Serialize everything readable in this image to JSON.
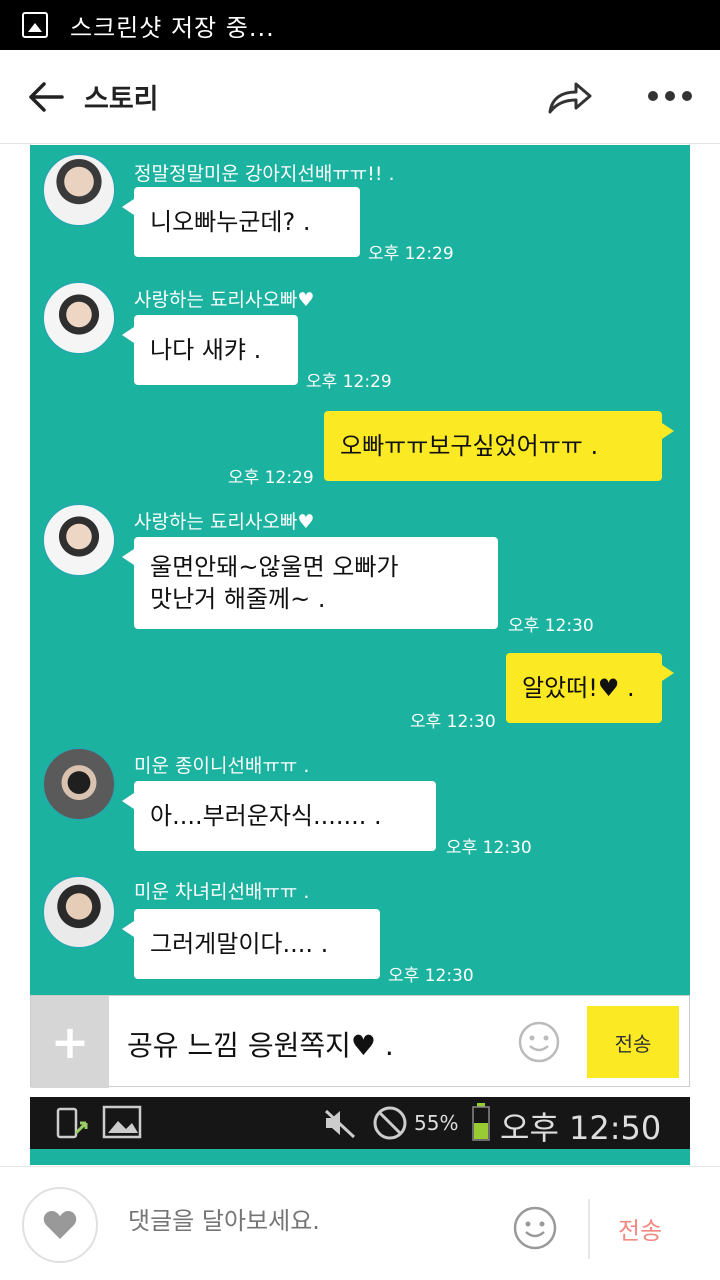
{
  "status_bar": {
    "text": "스크린샷 저장 중..."
  },
  "header": {
    "title": "스토리"
  },
  "chat": {
    "messages": [
      {
        "side": "left",
        "sender": "정말정말미운 강아지선배ㅠㅠ!! .",
        "lines": [
          "니오빠누군데? ."
        ],
        "time": "오후 12:29"
      },
      {
        "side": "left",
        "sender": "사랑하는 됴리사오빠♥",
        "lines": [
          "나다 새캬 ."
        ],
        "time": "오후 12:29"
      },
      {
        "side": "right",
        "lines": [
          "오빠ㅠㅠ보구싶었어ㅠㅠ ."
        ],
        "time": "오후 12:29"
      },
      {
        "side": "left",
        "sender": "사랑하는 됴리사오빠♥",
        "lines": [
          "울면안돼~않울면 오빠가",
          "맛난거 해줄께~ ."
        ],
        "time": "오후 12:30"
      },
      {
        "side": "right",
        "lines": [
          "알았떠!♥ ."
        ],
        "time": "오후 12:30"
      },
      {
        "side": "left",
        "sender": "미운 종이니선배ㅠㅠ .",
        "lines": [
          "아....부러운자식....... ."
        ],
        "time": "오후 12:30"
      },
      {
        "side": "left",
        "sender": "미운 차녀리선배ㅠㅠ .",
        "lines": [
          "그러게말이다.... ."
        ],
        "time": "오후 12:30"
      }
    ],
    "input_text": "공유 느낌 응원쪽지♥ .",
    "send_label": "전송"
  },
  "system_bar": {
    "battery": "55%",
    "clock": "오후 12:50"
  },
  "footer": {
    "placeholder": "댓글을 달아보세요.",
    "send_label": "전송"
  },
  "colors": {
    "chat_bg": "#1bb39f",
    "my_bubble": "#fbe923",
    "footer_send": "#f08a82"
  }
}
